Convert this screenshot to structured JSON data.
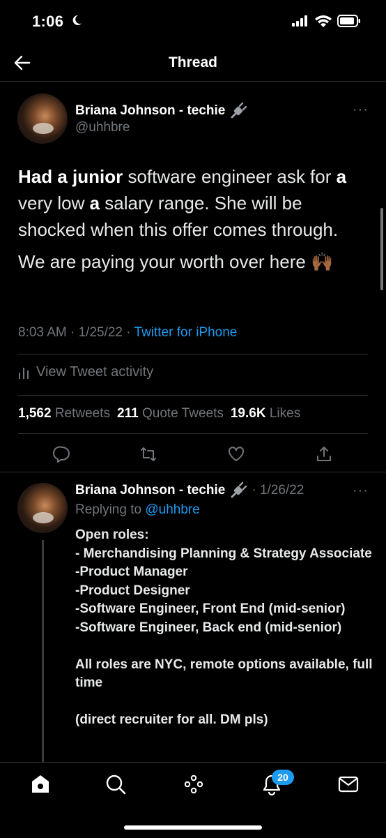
{
  "status_bar": {
    "time": "1:06"
  },
  "header": {
    "title": "Thread"
  },
  "tweet": {
    "author_name": "Briana Johnson - techie",
    "author_handle": "@uhhbre",
    "text_parts": [
      {
        "t": "Had a junior",
        "bold": true
      },
      {
        "t": " software engineer ask for ",
        "bold": false
      },
      {
        "t": "a",
        "bold": true
      },
      {
        "t": " very low ",
        "bold": false
      },
      {
        "t": "a",
        "bold": true
      },
      {
        "t": " salary range. She will be shocked when this offer comes through.",
        "bold": false
      }
    ],
    "text_second": "We are paying your worth over here 🙌🏾",
    "timestamp": "8:03 AM · 1/25/22 · ",
    "source": "Twitter for iPhone",
    "activity_label": "View Tweet activity",
    "stats": {
      "retweets_count": "1,562",
      "retweets_label": "Retweets",
      "quotes_count": "211",
      "quotes_label": "Quote Tweets",
      "likes_count": "19.6K",
      "likes_label": "Likes"
    }
  },
  "reply": {
    "author_name": "Briana Johnson - techie",
    "date": "· 1/26/22",
    "replying_label": "Replying to",
    "replying_handle": "@uhhbre",
    "body": "Open roles:\n- Merchandising Planning & Strategy Associate\n-Product Manager\n-Product Designer\n-Software Engineer, Front End (mid-senior)\n-Software Engineer, Back end (mid-senior)\n\nAll roles are NYC, remote options available, full time\n\n(direct recruiter for all. DM pls)"
  },
  "tab_bar": {
    "notifications_badge": "20"
  },
  "colors": {
    "background": "#000000",
    "accent": "#1d9bf0",
    "muted": "#71767b",
    "text": "#e7e9ea"
  },
  "icons": [
    "moon-icon",
    "signal-icon",
    "wifi-icon",
    "battery-icon",
    "back-arrow-icon",
    "plug-icon",
    "more-icon",
    "activity-icon",
    "reply-icon",
    "retweet-icon",
    "like-icon",
    "share-icon",
    "home-icon",
    "search-icon",
    "spaces-icon",
    "notifications-icon",
    "messages-icon"
  ]
}
